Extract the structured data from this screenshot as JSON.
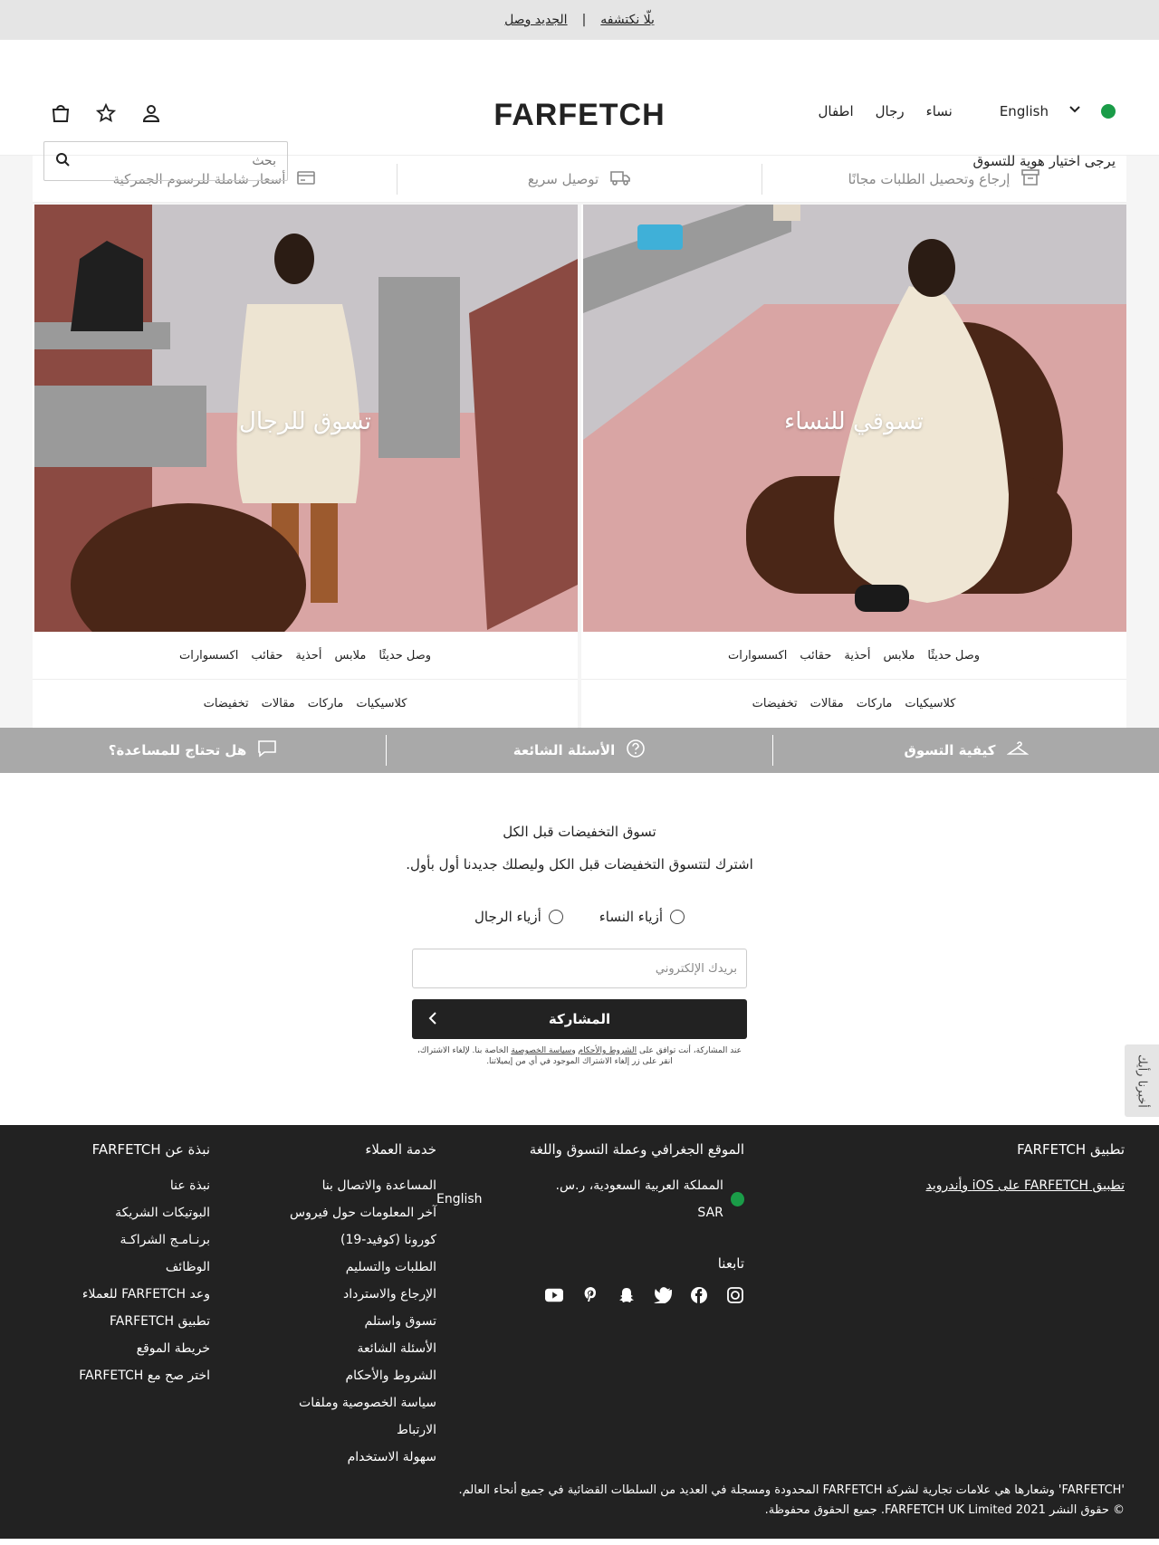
{
  "topbar": {
    "link1": "يلّا نكتشفه",
    "sep": "|",
    "link2": "الجديد وصل"
  },
  "header": {
    "logo": "FARFETCH",
    "language": "English",
    "nav": [
      "نساء",
      "رجال",
      "اطفال"
    ],
    "id_prompt": "يرجى اختيار هوية للتسوق",
    "search_placeholder": "بحث"
  },
  "usp": [
    "إرجاع وتحصيل الطلبات مجانًا",
    "توصيل سريع",
    "أسعار شاملة للرسوم الجمركية"
  ],
  "heroes": [
    {
      "label": "تسوقي للنساء",
      "row1": [
        "وصل حديثًا",
        "ملابس",
        "أحذية",
        "حقائب",
        "اكسسوارات"
      ],
      "row2": [
        "كلاسيكيات",
        "ماركات",
        "مقالات",
        "تخفيضات"
      ]
    },
    {
      "label": "تسوق للرجال",
      "row1": [
        "وصل حديثًا",
        "ملابس",
        "أحذية",
        "حقائب",
        "اكسسوارات"
      ],
      "row2": [
        "كلاسيكيات",
        "ماركات",
        "مقالات",
        "تخفيضات"
      ]
    }
  ],
  "help": [
    "كيفية التسوق",
    "الأسئلة الشائعة",
    "هل تحتاج للمساعدة؟"
  ],
  "newsletter": {
    "title": "تسوق التخفيضات قبل الكل",
    "subtitle": "اشترك لتتسوق التخفيضات قبل الكل وليصلك جديدنا أول بأول.",
    "women": "أزياء النساء",
    "men": "أزياء الرجال",
    "email_placeholder": "بريدك الإلكتروني",
    "submit": "المشاركة",
    "legal1": "عند المشاركة، أنت توافق على",
    "legal_terms": "الشروط والأحكام",
    "legal_and": "و",
    "legal_privacy": "سياسة الخصوصية",
    "legal2": "الخاصة بنا. لإلغاء الاشتراك،",
    "legal3": "انقر على زر إلغاء الاشتراك الموجود في أي من إيميلاتنا."
  },
  "feedback": "أخبرنا رأيك",
  "footer": {
    "about_title": "نبذة عن FARFETCH",
    "about": [
      "نبذة عنا",
      "البوتيكات الشريكة",
      "برنـامـج الشراكـة",
      "الوظائف",
      "وعد FARFETCH للعملاء",
      "تطبيق FARFETCH",
      "خريطة الموقع",
      "اختر صح مع FARFETCH"
    ],
    "service_title": "خدمة العملاء",
    "service": [
      "المساعدة والاتصال بنا",
      "آخر المعلومات حول فيروس كورونا (كوفيد-19)",
      "الطلبات والتسليم",
      "الإرجاع والاسترداد",
      "تسوق واستلم",
      "الأسئلة الشائعة",
      "الشروط والأحكام",
      "سياسة الخصوصية وملفات الارتباط",
      "سهولة الاستخدام"
    ],
    "region_title": "الموقع الجغرافي وعملة التسوق واللغة",
    "region": "المملكة العربية السعودية، ر.س. SAR",
    "region_lang": "English",
    "follow": "تابعنا",
    "app_title": "تطبيق FARFETCH",
    "app_link": "تطبيق FARFETCH على iOS وأندرويد",
    "copy1": "'FARFETCH' وشعارها هي علامات تجارية لشركة FARFETCH المحدودة ومسجلة في العديد من السلطات القضائية في جميع أنحاء العالم.",
    "copy2": "© حقوق النشر 2021 FARFETCH UK Limited. جميع الحقوق محفوظة."
  },
  "colors": {
    "accent": "#222222",
    "help_bar": "#a9a9a9",
    "topbar": "#e5e5e5"
  }
}
